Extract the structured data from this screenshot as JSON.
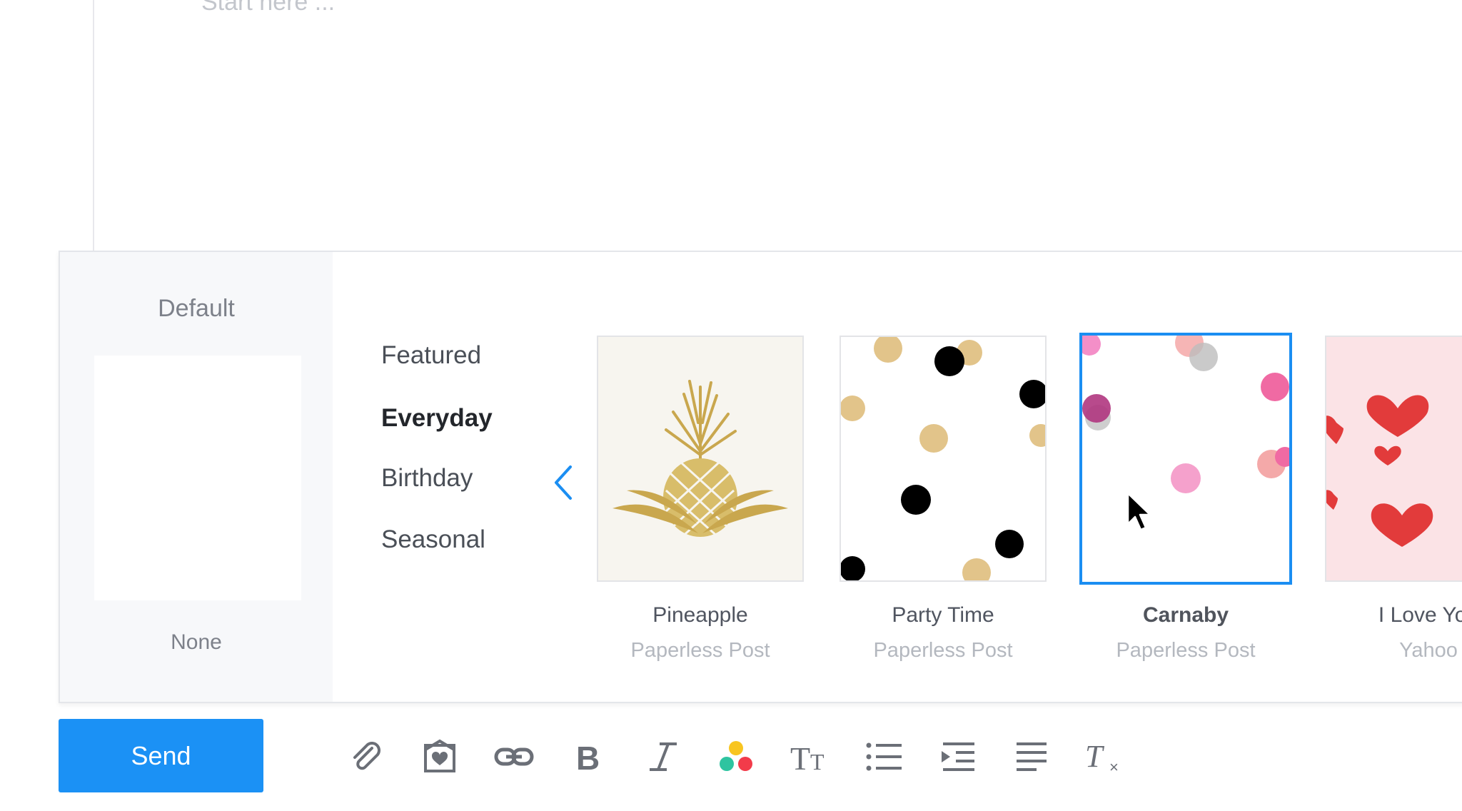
{
  "editor": {
    "placeholder": "Start here ..."
  },
  "stationery": {
    "default": {
      "title": "Default",
      "none_label": "None"
    },
    "categories": [
      {
        "label": "Featured",
        "active": false
      },
      {
        "label": "Everyday",
        "active": true
      },
      {
        "label": "Birthday",
        "active": false
      },
      {
        "label": "Seasonal",
        "active": false
      }
    ],
    "cards": [
      {
        "name": "Pineapple",
        "maker": "Paperless Post",
        "selected": false
      },
      {
        "name": "Party Time",
        "maker": "Paperless Post",
        "selected": false
      },
      {
        "name": "Carnaby",
        "maker": "Paperless Post",
        "selected": true
      },
      {
        "name": "I Love You",
        "maker": "Yahoo",
        "selected": false
      }
    ],
    "accent_color": "#1b8ef2"
  },
  "toolbar": {
    "send_label": "Send",
    "send_color": "#1b91f5",
    "icons": [
      "paperclip-icon",
      "stationery-icon",
      "link-icon",
      "bold-icon",
      "italic-icon",
      "color-icon",
      "font-size-icon",
      "bulleted-list-icon",
      "indent-icon",
      "align-icon",
      "clear-formatting-icon"
    ]
  }
}
